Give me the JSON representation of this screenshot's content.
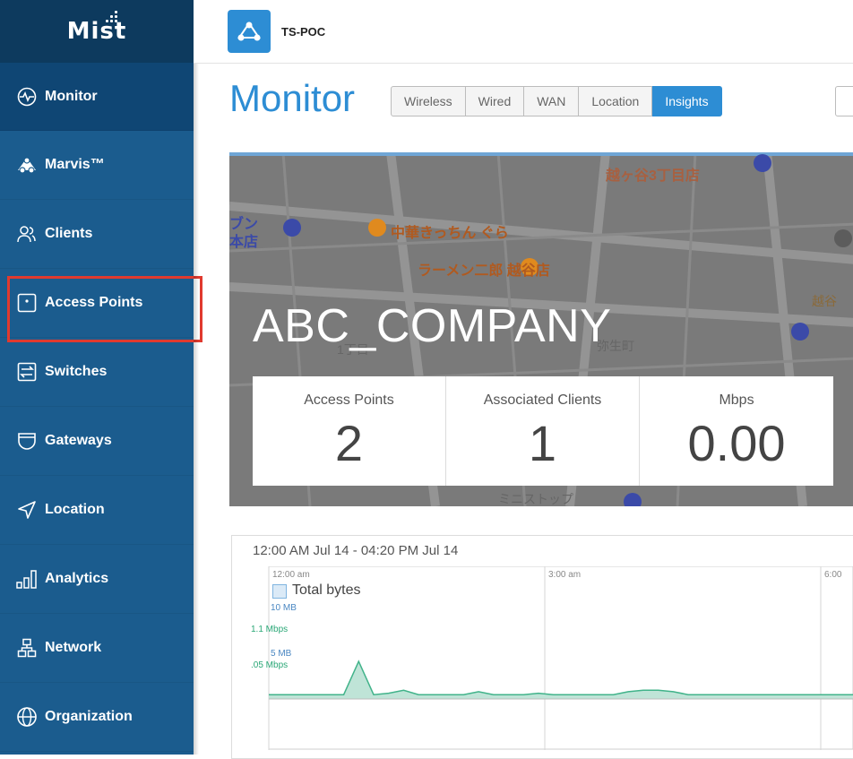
{
  "sidebar": {
    "brand": "Mist",
    "items": [
      {
        "label": "Monitor",
        "icon": "monitor-icon"
      },
      {
        "label": "Marvis™",
        "icon": "marvis-icon"
      },
      {
        "label": "Clients",
        "icon": "clients-icon"
      },
      {
        "label": "Access Points",
        "icon": "access-point-icon"
      },
      {
        "label": "Switches",
        "icon": "switch-icon"
      },
      {
        "label": "Gateways",
        "icon": "gateway-icon"
      },
      {
        "label": "Location",
        "icon": "location-icon"
      },
      {
        "label": "Analytics",
        "icon": "analytics-icon"
      },
      {
        "label": "Network",
        "icon": "network-icon"
      },
      {
        "label": "Organization",
        "icon": "organization-icon"
      }
    ]
  },
  "topbar": {
    "site_name": "TS-POC"
  },
  "page": {
    "title": "Monitor",
    "tabs": [
      "Wireless",
      "Wired",
      "WAN",
      "Location",
      "Insights"
    ],
    "active_tab": "Insights"
  },
  "hero": {
    "company": "ABC_COMPANY",
    "map_labels": [
      "越ヶ谷3丁目店",
      "中華きっちん ぐら",
      "ラーメン二郎 越谷店",
      "ブン",
      "本店",
      "弥生町",
      "越谷",
      "1丁目",
      "ミニストップ"
    ],
    "stats": [
      {
        "label": "Access Points",
        "value": "2"
      },
      {
        "label": "Associated Clients",
        "value": "1"
      },
      {
        "label": "Mbps",
        "value": "0.00"
      }
    ]
  },
  "chart_data": {
    "type": "area",
    "title": "12:00 AM Jul 14 - 04:20 PM Jul 14",
    "x_ticks": [
      "12:00 am",
      "3:00 am",
      "6:00"
    ],
    "y_ticks_left": [
      "10 MB",
      "5 MB"
    ],
    "y_ticks_rate": [
      "1.1 Mbps",
      ".05 Mbps"
    ],
    "series": [
      {
        "name": "Total bytes",
        "values": [
          0.3,
          0.3,
          0.3,
          0.3,
          0.3,
          0.3,
          2.6,
          0.3,
          0.4,
          0.6,
          0.3,
          0.3,
          0.3,
          0.3,
          0.5,
          0.3,
          0.3,
          0.3,
          0.4,
          0.3,
          0.3,
          0.3,
          0.3,
          0.3,
          0.5,
          0.6,
          0.6,
          0.5,
          0.3,
          0.3,
          0.3,
          0.3,
          0.3,
          0.3,
          0.3,
          0.3,
          0.3,
          0.3,
          0.3,
          0.3
        ]
      }
    ],
    "colors": {
      "fill": "#bfe4d7",
      "line": "#41b38a"
    }
  }
}
